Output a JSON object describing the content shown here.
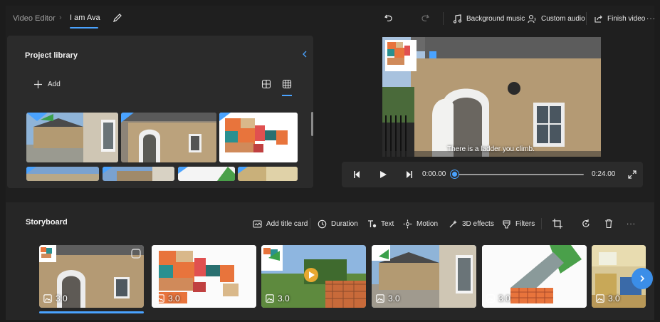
{
  "topbar": {
    "breadcrumb_root": "Video Editor",
    "project_name": "I am Ava",
    "background_music_label": "Background music",
    "custom_audio_label": "Custom audio",
    "finish_video_label": "Finish video",
    "more_label": "···"
  },
  "library": {
    "title": "Project library",
    "add_label": "Add"
  },
  "preview": {
    "subtitle": "There is a ladder you climb."
  },
  "player": {
    "current_time": "0:00.00",
    "total_time": "0:24.00",
    "progress": 0
  },
  "storyboard": {
    "title": "Storyboard",
    "add_title_card_label": "Add title card",
    "duration_label": "Duration",
    "text_label": "Text",
    "motion_label": "Motion",
    "effects_label": "3D effects",
    "filters_label": "Filters",
    "more_label": "···",
    "clips": [
      {
        "duration": "3.0",
        "kind": "house-arch"
      },
      {
        "duration": "3.0",
        "kind": "floorplan"
      },
      {
        "duration": "3.0",
        "kind": "garden-video"
      },
      {
        "duration": "3.0",
        "kind": "house-front"
      },
      {
        "duration": "3.0",
        "kind": "floorplan-green"
      },
      {
        "duration": "3.0",
        "kind": "room"
      }
    ]
  },
  "colors": {
    "accent": "#4aa3ff",
    "panel": "#2b2b2b",
    "background": "#1f1f1f"
  }
}
